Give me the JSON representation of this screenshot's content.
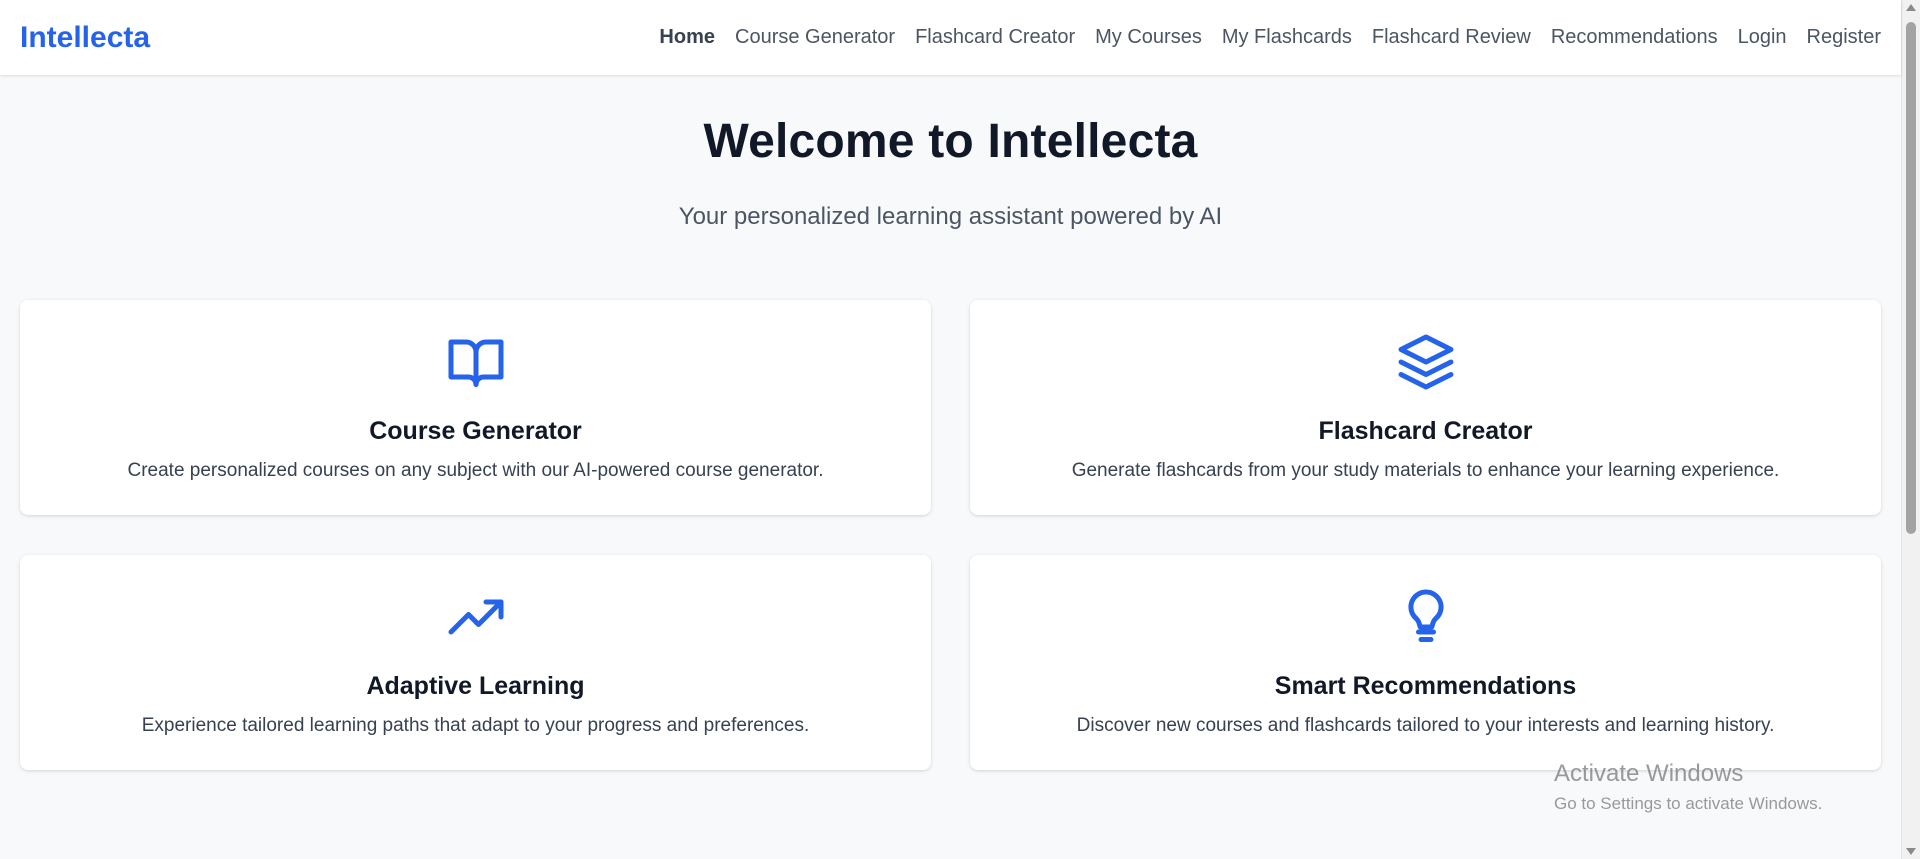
{
  "header": {
    "brand": "Intellecta",
    "nav": [
      {
        "label": "Home",
        "active": true
      },
      {
        "label": "Course Generator"
      },
      {
        "label": "Flashcard Creator"
      },
      {
        "label": "My Courses"
      },
      {
        "label": "My Flashcards"
      },
      {
        "label": "Flashcard Review"
      },
      {
        "label": "Recommendations"
      },
      {
        "label": "Login"
      },
      {
        "label": "Register"
      }
    ]
  },
  "hero": {
    "title": "Welcome to Intellecta",
    "subtitle": "Your personalized learning assistant powered by AI"
  },
  "cards": [
    {
      "icon": "book-open-icon",
      "title": "Course Generator",
      "description": "Create personalized courses on any subject with our AI-powered course generator."
    },
    {
      "icon": "layers-icon",
      "title": "Flashcard Creator",
      "description": "Generate flashcards from your study materials to enhance your learning experience."
    },
    {
      "icon": "trending-up-icon",
      "title": "Adaptive Learning",
      "description": "Experience tailored learning paths that adapt to your progress and preferences."
    },
    {
      "icon": "lightbulb-icon",
      "title": "Smart Recommendations",
      "description": "Discover new courses and flashcards tailored to your interests and learning history."
    }
  ],
  "watermark": {
    "line1": "Activate Windows",
    "line2": "Go to Settings to activate Windows."
  },
  "colors": {
    "accent": "#2563eb",
    "background": "#f8f9fb",
    "card": "#ffffff"
  }
}
